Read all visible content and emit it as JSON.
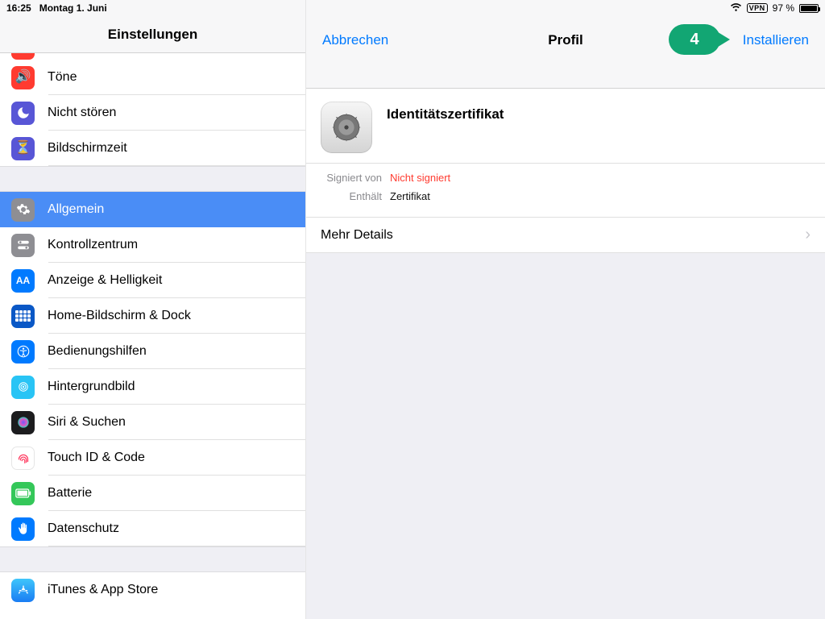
{
  "statusbar": {
    "time": "16:25",
    "date": "Montag 1. Juni",
    "vpn": "VPN",
    "battery_pct": "97 %"
  },
  "sidebar": {
    "title": "Einstellungen",
    "items_top": [
      {
        "label": "Töne",
        "icon": "sounds-icon",
        "color": "bg-red"
      },
      {
        "label": "Nicht stören",
        "icon": "moon-icon",
        "color": "bg-indigo"
      },
      {
        "label": "Bildschirmzeit",
        "icon": "hourglass-icon",
        "color": "bg-indigo"
      }
    ],
    "items_mid": [
      {
        "label": "Allgemein",
        "icon": "gear-icon",
        "color": "bg-gray",
        "selected": true
      },
      {
        "label": "Kontrollzentrum",
        "icon": "switches-icon",
        "color": "bg-gray"
      },
      {
        "label": "Anzeige & Helligkeit",
        "icon": "aa-icon",
        "color": "bg-blue"
      },
      {
        "label": "Home-Bildschirm & Dock",
        "icon": "grid-icon",
        "color": "bg-darkblue"
      },
      {
        "label": "Bedienungshilfen",
        "icon": "accessibility-icon",
        "color": "bg-blue"
      },
      {
        "label": "Hintergrundbild",
        "icon": "wallpaper-icon",
        "color": "bg-cyan"
      },
      {
        "label": "Siri & Suchen",
        "icon": "siri-icon",
        "color": "bg-black"
      },
      {
        "label": "Touch ID & Code",
        "icon": "fingerprint-icon",
        "color": "bg-touch"
      },
      {
        "label": "Batterie",
        "icon": "battery-icon",
        "color": "bg-green"
      },
      {
        "label": "Datenschutz",
        "icon": "hand-icon",
        "color": "bg-blue"
      }
    ],
    "items_bottom": [
      {
        "label": "iTunes & App Store",
        "icon": "appstore-icon",
        "color": "bg-light"
      }
    ]
  },
  "detail": {
    "cancel": "Abbrechen",
    "title": "Profil",
    "install": "Installieren",
    "callout_number": "4",
    "profile_name": "Identitätszertifikat",
    "signed_by_label": "Signiert von",
    "signed_by_value": "Nicht signiert",
    "contains_label": "Enthält",
    "contains_value": "Zertifikat",
    "more_details": "Mehr Details"
  }
}
